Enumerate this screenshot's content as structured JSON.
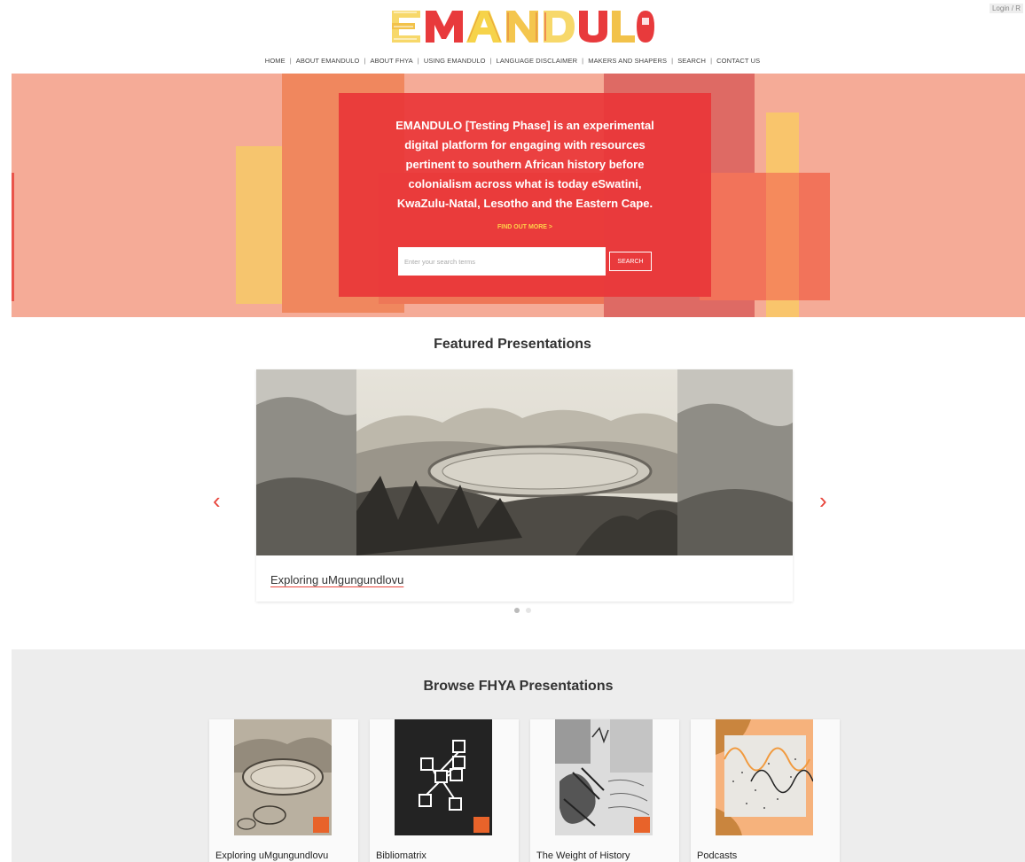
{
  "header": {
    "logo_text": "EMANDULO",
    "login_label": "Login / R"
  },
  "nav": {
    "items": [
      "HOME",
      "ABOUT EMANDULO",
      "ABOUT FHYA",
      "USING EMANDULO",
      "LANGUAGE DISCLAIMER",
      "MAKERS AND SHAPERS",
      "SEARCH",
      "CONTACT US"
    ],
    "separator": "|"
  },
  "hero": {
    "text": "EMANDULO [Testing Phase] is an experimental digital platform for engaging with resources pertinent to southern African history before colonialism across what is today eSwatini, KwaZulu-Natal, Lesotho and the Eastern Cape.",
    "find_out_more": "FIND OUT MORE >",
    "search_placeholder": "Enter your search terms",
    "search_button": "SEARCH"
  },
  "featured": {
    "title": "Featured Presentations",
    "caption": "Exploring uMgungundlovu",
    "prev_icon": "‹",
    "next_icon": "›",
    "slide_count": 2,
    "active_slide": 1
  },
  "browse": {
    "title": "Browse FHYA Presentations",
    "cards": [
      {
        "title": "Exploring uMgungundlovu"
      },
      {
        "title": "Bibliomatrix"
      },
      {
        "title": "The Weight of History"
      },
      {
        "title": "Podcasts"
      }
    ]
  },
  "colors": {
    "hero_bg": "#f5ab97",
    "hero_box": "#e93638",
    "accent": "#e8453c",
    "link_yellow": "#ffd24a",
    "browse_bg": "#ededed"
  }
}
